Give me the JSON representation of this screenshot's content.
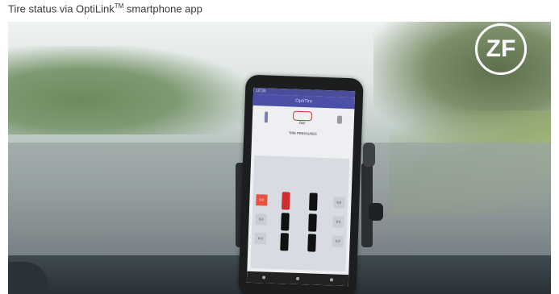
{
  "caption": {
    "text": "Tire status via OptiLink",
    "tm": "TM",
    "suffix": " smartphone app"
  },
  "logo": {
    "text": "ZF"
  },
  "phone": {
    "app_title": "OptiTire",
    "status_time": "10:35",
    "unit": "bar",
    "section_title": "TIRE PRESSURES",
    "wheel_labels": [
      "0.0",
      "0.0",
      "0.0",
      "0.0",
      "0.0",
      "0.0"
    ]
  },
  "colors": {
    "app_primary": "#4b4fa6",
    "alert_red": "#d02e2e",
    "logo_white": "#ffffff"
  }
}
